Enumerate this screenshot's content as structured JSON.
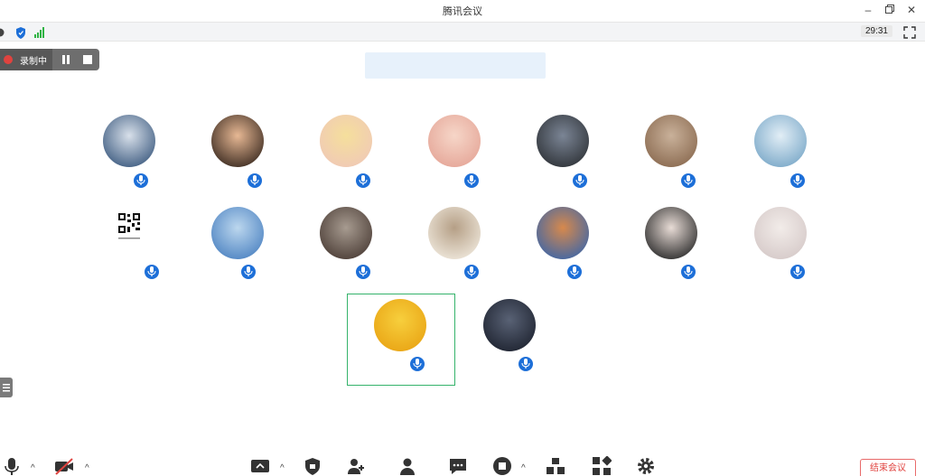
{
  "window": {
    "title": "腾讯会议"
  },
  "timer": {
    "elapsed": "29:31"
  },
  "recording": {
    "label": "录制中"
  },
  "participants": [
    {
      "id": "p1",
      "avatar": "person-back-portrait",
      "colors": [
        "#3d5b80",
        "#d8e0ea"
      ]
    },
    {
      "id": "p2",
      "avatar": "baby-face",
      "colors": [
        "#3a2a20",
        "#e7b894"
      ]
    },
    {
      "id": "p3",
      "avatar": "cartoon-face",
      "colors": [
        "#f0c9b6",
        "#f5df9c"
      ]
    },
    {
      "id": "p4",
      "avatar": "child-face",
      "colors": [
        "#e5a698",
        "#f6d6c8"
      ]
    },
    {
      "id": "p5",
      "avatar": "street-scene",
      "colors": [
        "#2f3338",
        "#7b8595"
      ]
    },
    {
      "id": "p6",
      "avatar": "camels",
      "colors": [
        "#8a6a50",
        "#c9b19a"
      ]
    },
    {
      "id": "p7",
      "avatar": "beach-person",
      "colors": [
        "#7aa8c8",
        "#e2eef6"
      ]
    },
    {
      "id": "p8",
      "avatar": "qr-code",
      "colors": [
        "#111111",
        "#ffffff"
      ]
    },
    {
      "id": "p9",
      "avatar": "lake-tree",
      "colors": [
        "#4d83c2",
        "#bcd7ee"
      ]
    },
    {
      "id": "p10",
      "avatar": "stone-building",
      "colors": [
        "#4b3d36",
        "#a79b90"
      ]
    },
    {
      "id": "p11",
      "avatar": "sketch-boy",
      "colors": [
        "#efe8dc",
        "#b59f86"
      ]
    },
    {
      "id": "p12",
      "avatar": "sunset-field",
      "colors": [
        "#3d66a8",
        "#d7894c"
      ]
    },
    {
      "id": "p13",
      "avatar": "girl-portrait",
      "colors": [
        "#2a2a2a",
        "#e8dcd6"
      ]
    },
    {
      "id": "p14",
      "avatar": "girl-with-cat",
      "colors": [
        "#d5c9c8",
        "#f2ece9"
      ]
    },
    {
      "id": "p15",
      "avatar": "sunflower",
      "colors": [
        "#e9a414",
        "#f7cf3d"
      ]
    },
    {
      "id": "p16",
      "avatar": "man-in-dark",
      "colors": [
        "#1e2330",
        "#596275"
      ]
    }
  ],
  "toolbar": {
    "items": [
      {
        "icon": "microphone-icon"
      },
      {
        "icon": "camera-off-icon"
      },
      {
        "icon": "share-screen-icon"
      },
      {
        "icon": "security-shield-icon"
      },
      {
        "icon": "invite-icon"
      },
      {
        "icon": "members-icon"
      },
      {
        "icon": "chat-icon"
      },
      {
        "icon": "record-icon"
      },
      {
        "icon": "layout-icon"
      },
      {
        "icon": "apps-icon"
      },
      {
        "icon": "settings-icon"
      }
    ],
    "end_label": "结束会议"
  },
  "colors": {
    "accent": "#1d6fd8",
    "active_border": "#35b36b",
    "danger": "#e0433f"
  }
}
